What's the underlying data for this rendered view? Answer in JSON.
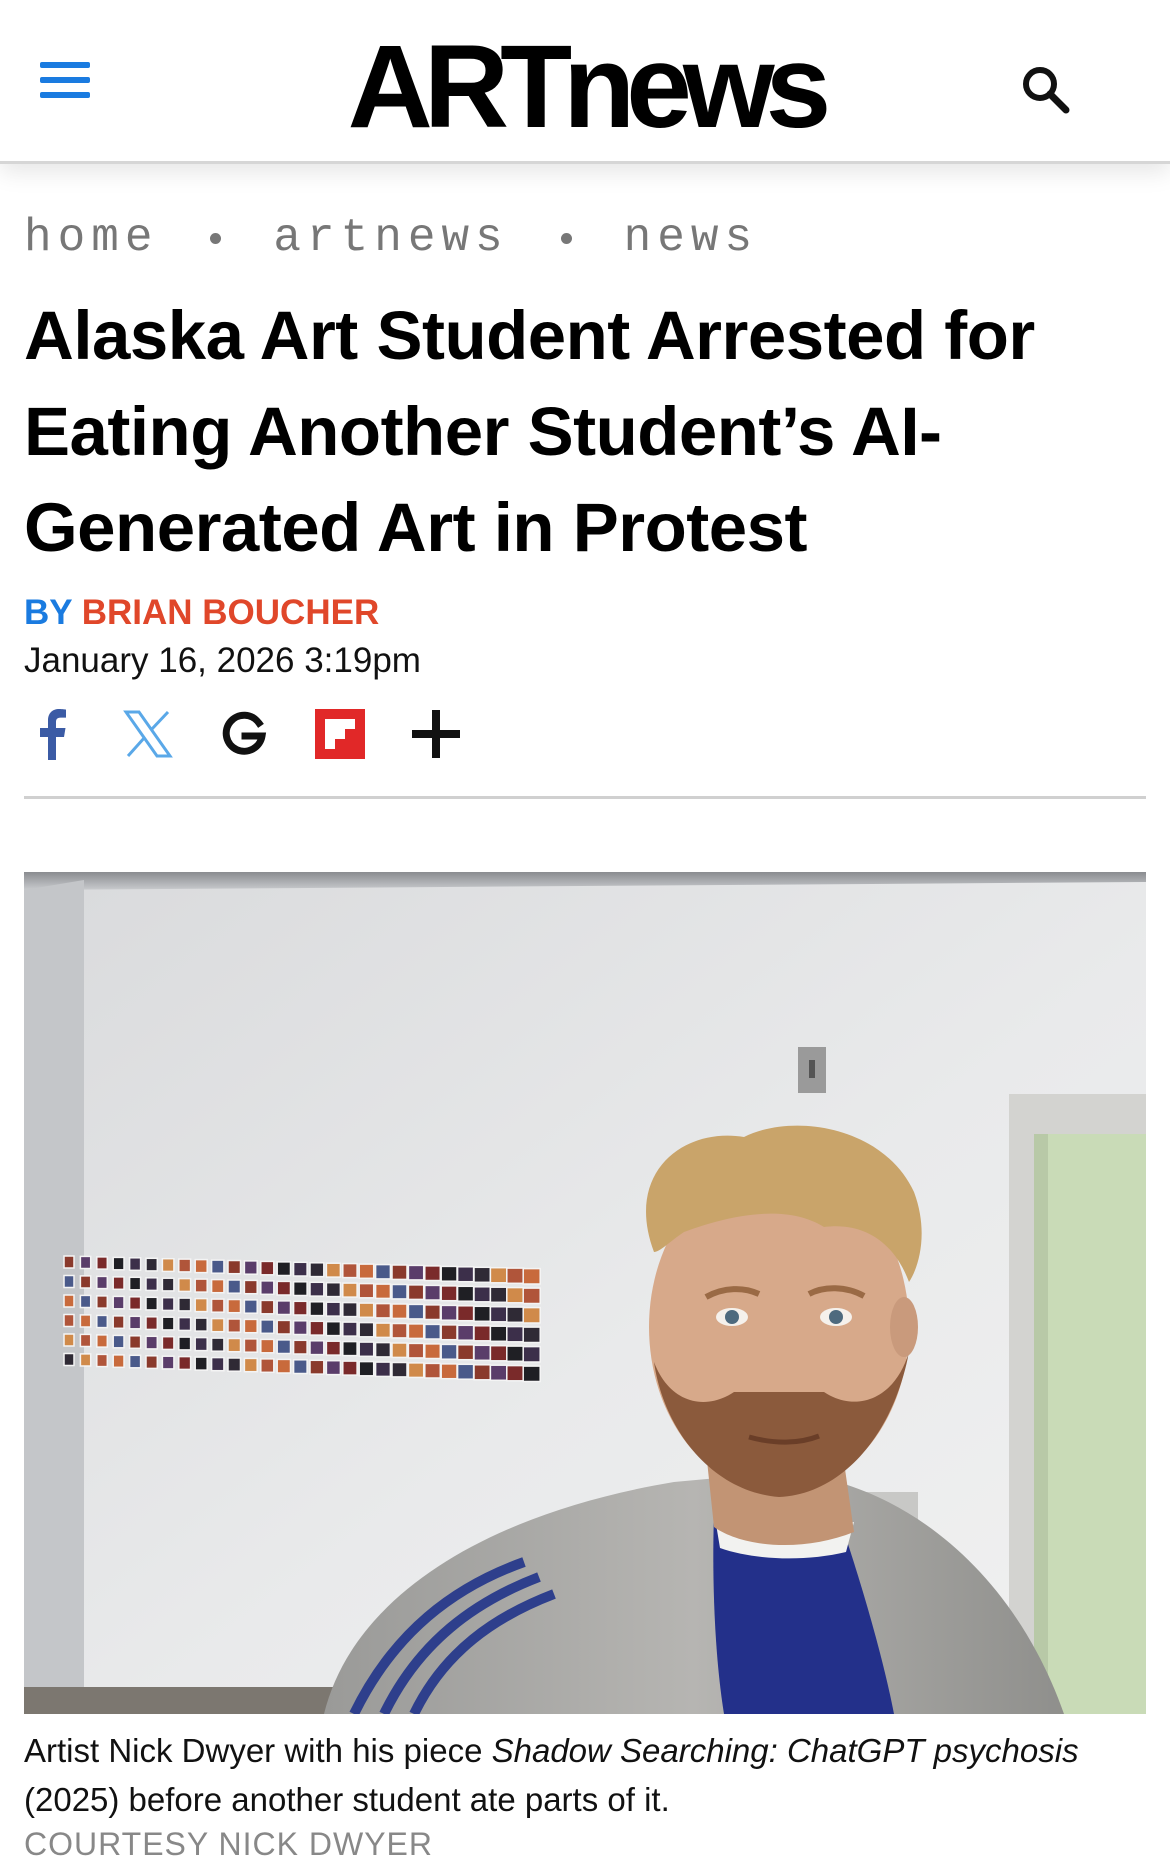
{
  "header": {
    "logo": "ARTnews",
    "menu_icon": "hamburger-menu-icon",
    "search_icon": "search-icon",
    "accent_color": "#1a7be0"
  },
  "breadcrumb": [
    "home",
    "artnews",
    "news"
  ],
  "article": {
    "title": "Alaska Art Student Arrested for Eating Another Student’s AI-Generated Art in Protest",
    "byline_prefix": "BY",
    "author": "BRIAN BOUCHER",
    "author_color": "#e0472a",
    "date": "January 16, 2026 3:19pm"
  },
  "share": [
    {
      "icon": "facebook-icon",
      "color": "#3b5ba5"
    },
    {
      "icon": "x-icon",
      "color": "#5aa8e8"
    },
    {
      "icon": "google-icon",
      "color": "#111111"
    },
    {
      "icon": "flipboard-icon",
      "color": "#e12828"
    },
    {
      "icon": "plus-icon",
      "color": "#111111"
    }
  ],
  "photo": {
    "caption_pre": "Artist Nick Dwyer with his piece ",
    "caption_italic": "Shadow Searching: ChatGPT psychosis",
    "caption_post": " (2025) before another student ate parts of it.",
    "credit": "COURTESY NICK DWYER"
  }
}
